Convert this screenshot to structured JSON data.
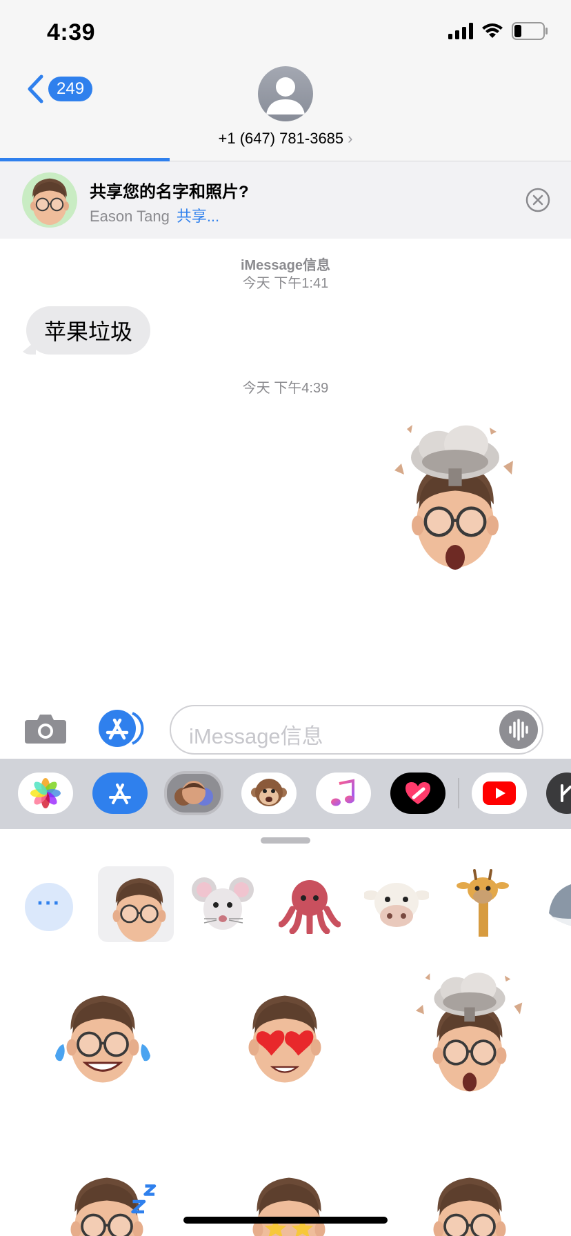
{
  "status_bar": {
    "time": "4:39"
  },
  "nav": {
    "unread_count": "249",
    "contact_number": "+1 (647) 781-3685",
    "chevron": "›"
  },
  "share_banner": {
    "title": "共享您的名字和照片?",
    "name": "Eason Tang",
    "action": "共享..."
  },
  "conversation": {
    "service_label": "iMessage信息",
    "timestamp_1": "今天 下午1:41",
    "message_1": "苹果垃圾",
    "timestamp_2": "今天 下午4:39"
  },
  "composer": {
    "placeholder": "iMessage信息"
  },
  "app_strip": {
    "items": [
      "photos",
      "app-store",
      "memoji-stickers",
      "animoji",
      "music",
      "digital-touch",
      "youtube",
      "more-app"
    ]
  },
  "drawer": {
    "more_label": "···",
    "characters": [
      "memoji",
      "mouse",
      "octopus",
      "cow",
      "giraffe",
      "shark"
    ]
  },
  "colors": {
    "accent": "#2f80ed",
    "bubble_gray": "#e9e9eb",
    "bar_gray": "#f6f6f6"
  }
}
